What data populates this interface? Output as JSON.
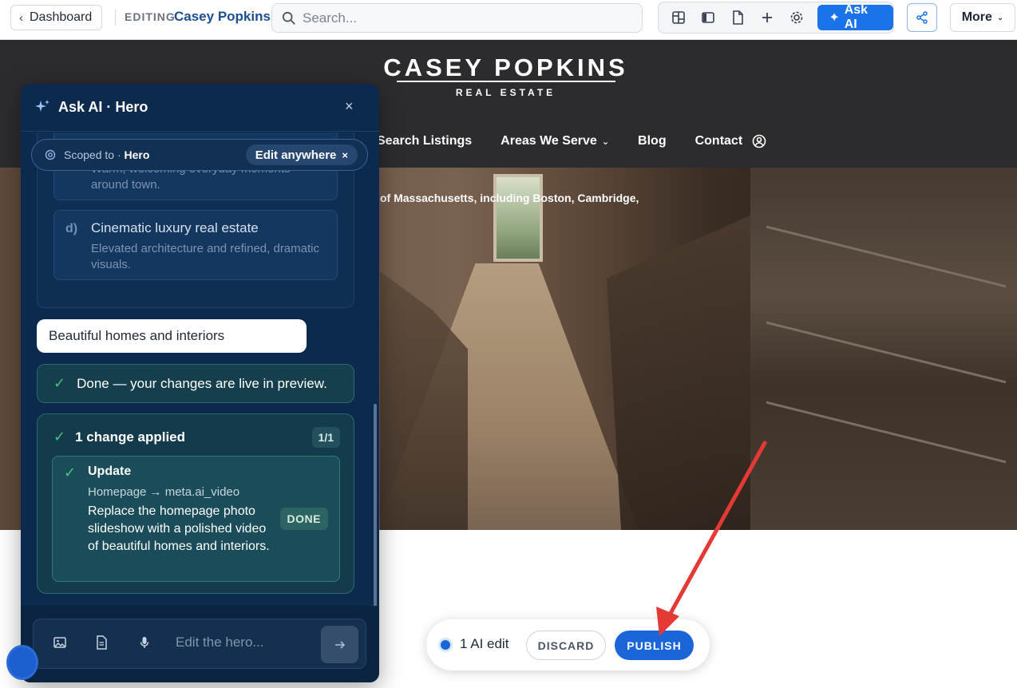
{
  "topbar": {
    "back_label": "Dashboard",
    "editing_label": "EDITING",
    "editing_name": "Casey Popkins",
    "search_placeholder": "Search...",
    "ask_ai_label": "Ask AI",
    "more_label": "More"
  },
  "site": {
    "logo_title": "CASEY POPKINS",
    "logo_subtitle": "REAL ESTATE",
    "nav": [
      "Search Listings",
      "Areas We Serve",
      "Blog",
      "Contact"
    ],
    "hero_text": "of Massachusetts, including Boston, Cambridge,"
  },
  "panel": {
    "title": "Ask AI · Hero",
    "scope_prefix": "Scoped to · ",
    "scope_target": "Hero",
    "scope_chip": "Edit anywhere",
    "options": [
      {
        "letter": "",
        "title": "",
        "desc": "Warm, welcoming everyday moments around town."
      },
      {
        "letter": "d)",
        "title": "Cinematic luxury real estate",
        "desc": "Elevated architecture and refined, dramatic visuals."
      }
    ],
    "user_message": "Beautiful homes and interiors",
    "done_message": "Done — your changes are live in preview.",
    "change_header": "1 change applied",
    "change_count": "1/1",
    "update": {
      "title": "Update",
      "path": "Homepage → meta.ai_video",
      "desc": "Replace the homepage photo slideshow with a polished video of beautiful homes and interiors.",
      "status": "DONE"
    },
    "composer_placeholder": "Edit the hero..."
  },
  "publish_bar": {
    "edits_label": "1 AI edit",
    "discard_label": "DISCARD",
    "publish_label": "PUBLISH"
  },
  "colors": {
    "accent": "#1a73e8",
    "panel_bg": "#0c2a4d",
    "success": "#49c37a",
    "annotation": "#e53935"
  }
}
